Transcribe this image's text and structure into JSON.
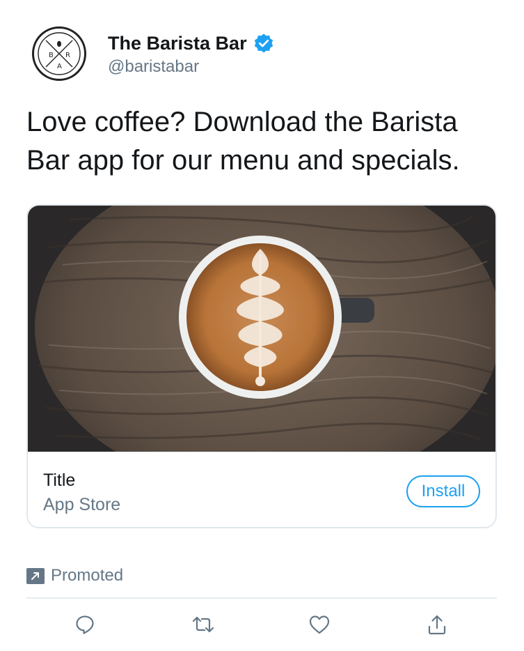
{
  "account": {
    "display_name": "The Barista Bar",
    "handle": "@baristabar",
    "verified": true,
    "avatar_letters": [
      "B",
      "R",
      "A"
    ]
  },
  "tweet": {
    "text": "Love coffee? Download the Barista Bar app for our menu and specials."
  },
  "card": {
    "title": "Title",
    "subtitle": "App Store",
    "install_label": "Install"
  },
  "promoted": {
    "label": "Promoted"
  },
  "colors": {
    "accent": "#1da1f2",
    "secondary_text": "#657786",
    "primary_text": "#14171a",
    "border": "#e1e8ed"
  },
  "icons": {
    "verified": "verified-badge-icon",
    "promoted": "promoted-arrow-icon",
    "reply": "reply-icon",
    "retweet": "retweet-icon",
    "like": "heart-icon",
    "share": "share-icon"
  }
}
